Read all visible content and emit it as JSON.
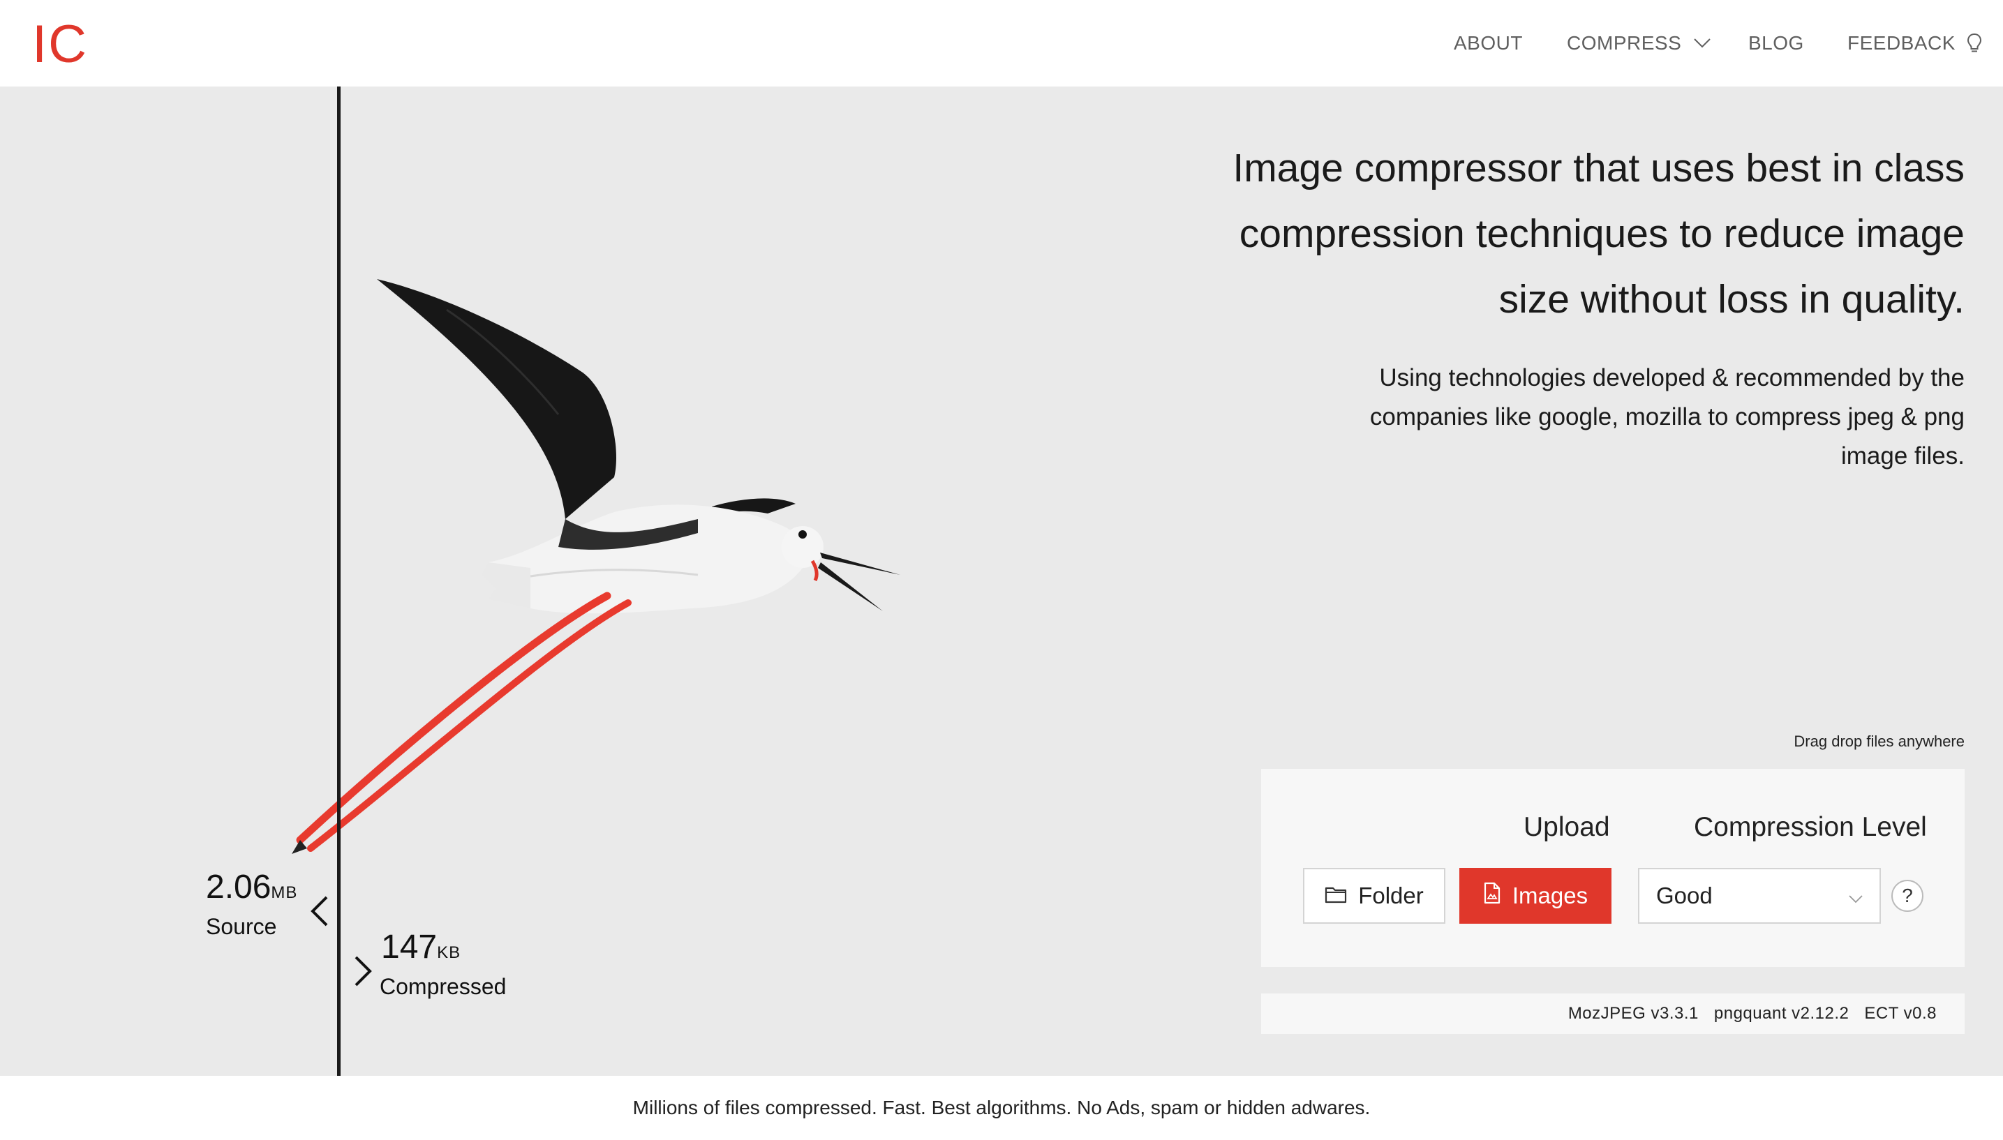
{
  "brand": {
    "logo_text": "IC",
    "accent_color": "#e0372b"
  },
  "nav": {
    "about": "ABOUT",
    "compress": "COMPRESS",
    "blog": "BLOG",
    "feedback": "FEEDBACK"
  },
  "hero": {
    "headline_lines": [
      "Image compressor that uses best in class",
      "compression techniques to reduce image",
      "size without loss in quality."
    ],
    "subline_lines": [
      "Using technologies developed & recommended by the",
      "companies like google, mozilla to compress jpeg & png",
      "image files."
    ],
    "drag_hint": "Drag drop files anywhere"
  },
  "comparison": {
    "source": {
      "value": "2.06",
      "unit": "MB",
      "label": "Source"
    },
    "compressed": {
      "value": "147",
      "unit": "KB",
      "label": "Compressed"
    }
  },
  "upload": {
    "title": "Upload",
    "folder_label": "Folder",
    "images_label": "Images"
  },
  "compression": {
    "title": "Compression Level",
    "selected": "Good",
    "help": "?"
  },
  "versions": [
    "MozJPEG v3.3.1",
    "pngquant v2.12.2",
    "ECT v0.8"
  ],
  "footer": {
    "text": "Millions of files compressed. Fast. Best algorithms. No Ads, spam or hidden adwares."
  }
}
